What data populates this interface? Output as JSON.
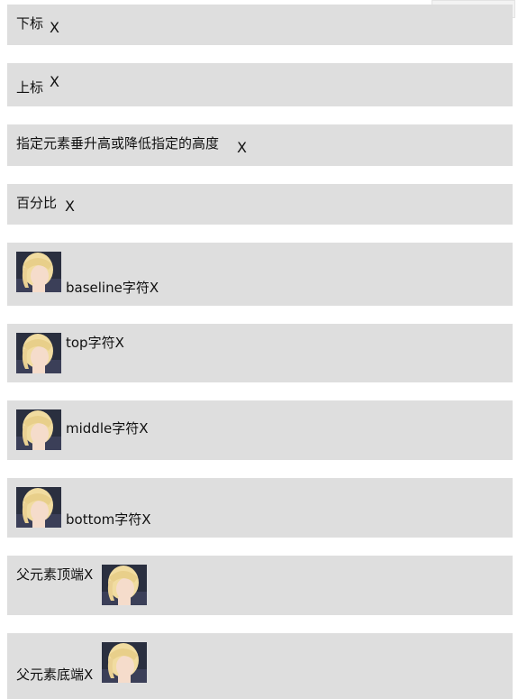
{
  "devtools": {
    "size_badge": "577px × 937px"
  },
  "rows": {
    "sub": {
      "text": "下标",
      "x": "X"
    },
    "sup": {
      "text": "上标",
      "x": "X"
    },
    "length": {
      "text": "指定元素垂升高或降低指定的高度",
      "x": "X"
    },
    "percent": {
      "text": "百分比",
      "x": "X"
    },
    "baseline": {
      "text": "baseline字符X"
    },
    "top": {
      "text": "top字符X"
    },
    "middle": {
      "text": "middle字符X"
    },
    "bottom": {
      "text": "bottom字符X"
    },
    "text_top": {
      "text": "父元素顶端X"
    },
    "text_bottom": {
      "text": "父元素底端X"
    }
  },
  "colors": {
    "row_bg": "#dedede",
    "text": "#111111",
    "hair": "#f1dca0",
    "skin": "#f5dccb"
  },
  "icons": {
    "avatar": "anime-girl-avatar-image"
  }
}
